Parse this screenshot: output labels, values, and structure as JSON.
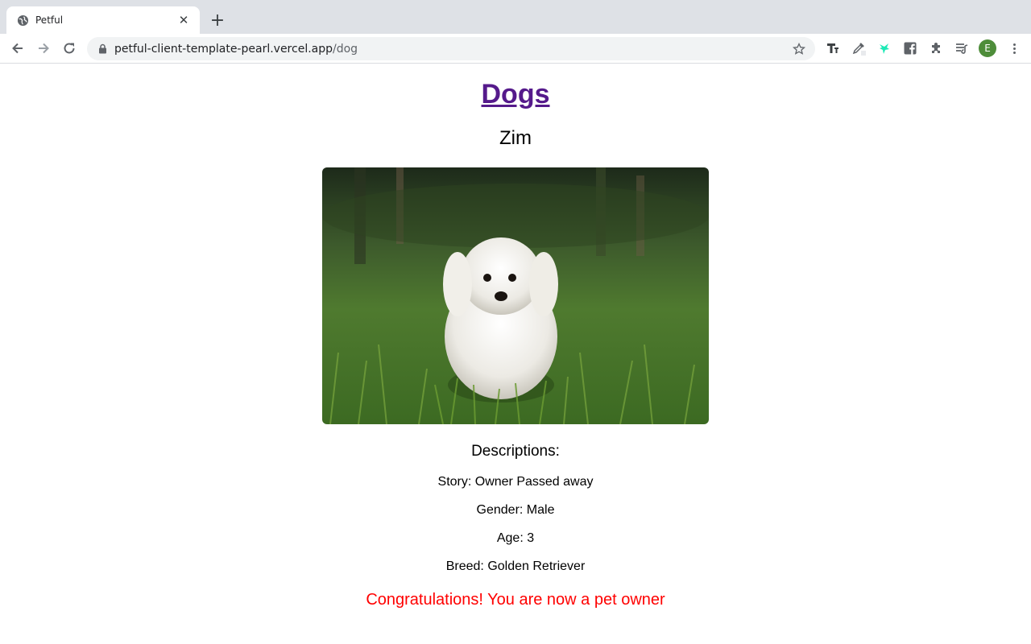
{
  "browser": {
    "tab_title": "Petful",
    "url_host": "petful-client-template-pearl.vercel.app",
    "url_path": "/dog",
    "avatar_letter": "E"
  },
  "page": {
    "title": "Dogs",
    "pet_name": "Zim",
    "descriptions_heading": "Descriptions:",
    "story": "Story: Owner Passed away",
    "gender": "Gender: Male",
    "age": "Age: 3",
    "breed": "Breed: Golden Retriever",
    "congrats": "Congratulations! You are now a pet owner"
  },
  "colors": {
    "link_visited": "#551a8b",
    "congrats": "#ff0000",
    "avatar": "#4e8d3a"
  }
}
